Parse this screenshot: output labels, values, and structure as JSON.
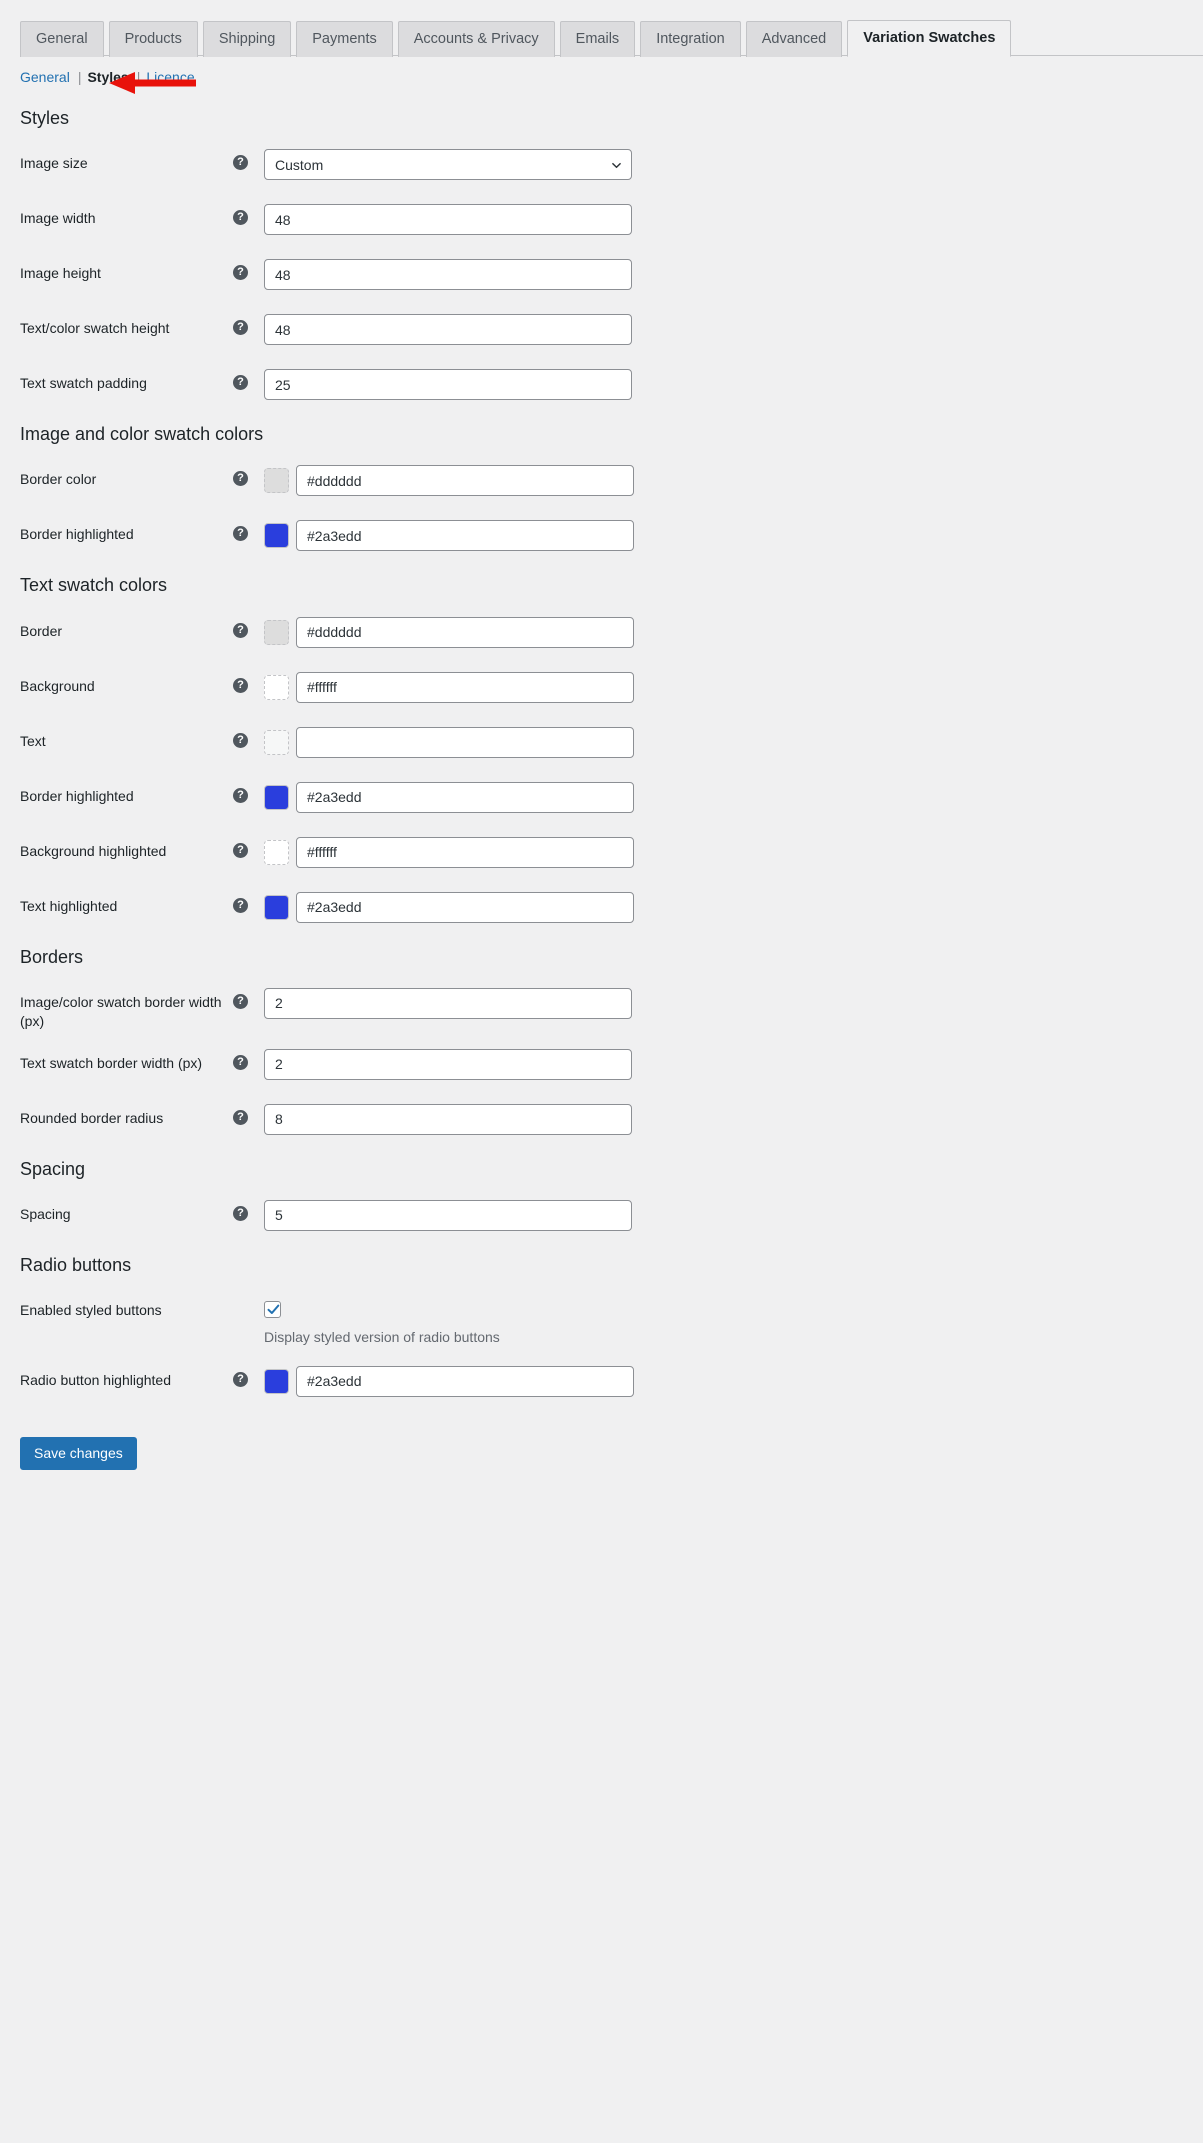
{
  "tabs": [
    {
      "label": "General",
      "active": false
    },
    {
      "label": "Products",
      "active": false
    },
    {
      "label": "Shipping",
      "active": false
    },
    {
      "label": "Payments",
      "active": false
    },
    {
      "label": "Accounts & Privacy",
      "active": false
    },
    {
      "label": "Emails",
      "active": false
    },
    {
      "label": "Integration",
      "active": false
    },
    {
      "label": "Advanced",
      "active": false
    },
    {
      "label": "Variation Swatches",
      "active": true
    }
  ],
  "subnav": {
    "items": [
      {
        "label": "General",
        "current": false
      },
      {
        "label": "Styles",
        "current": true
      },
      {
        "label": "Licence",
        "current": false
      }
    ],
    "separator": "|"
  },
  "annotation": {
    "arrow_color": "#e8120b",
    "points_at": "Licence"
  },
  "help_icon_glyph": "?",
  "sections": [
    {
      "title": "Styles",
      "rows": [
        {
          "label": "Image size",
          "type": "select",
          "value": "Custom",
          "help": true
        },
        {
          "label": "Image width",
          "type": "text",
          "value": "48",
          "help": true
        },
        {
          "label": "Image height",
          "type": "text",
          "value": "48",
          "help": true
        },
        {
          "label": "Text/color swatch height",
          "type": "text",
          "value": "48",
          "help": true
        },
        {
          "label": "Text swatch padding",
          "type": "text",
          "value": "25",
          "help": true
        }
      ]
    },
    {
      "title": "Image and color swatch colors",
      "rows": [
        {
          "label": "Border color",
          "type": "color",
          "value": "#dddddd",
          "swatch": "#dddddd",
          "swatch_style": "dashed",
          "help": true
        },
        {
          "label": "Border highlighted",
          "type": "color",
          "value": "#2a3edd",
          "swatch": "#2a3edd",
          "swatch_style": "solid",
          "help": true
        }
      ]
    },
    {
      "title": "Text swatch colors",
      "rows": [
        {
          "label": "Border",
          "type": "color",
          "value": "#dddddd",
          "swatch": "#dddddd",
          "swatch_style": "dashed",
          "help": true
        },
        {
          "label": "Background",
          "type": "color",
          "value": "#ffffff",
          "swatch": "#ffffff",
          "swatch_style": "dashed",
          "help": true
        },
        {
          "label": "Text",
          "type": "color",
          "value": "",
          "swatch": "#f6f7f7",
          "swatch_style": "dashed",
          "help": true
        },
        {
          "label": "Border highlighted",
          "type": "color",
          "value": "#2a3edd",
          "swatch": "#2a3edd",
          "swatch_style": "solid",
          "help": true
        },
        {
          "label": "Background highlighted",
          "type": "color",
          "value": "#ffffff",
          "swatch": "#ffffff",
          "swatch_style": "dashed",
          "help": true
        },
        {
          "label": "Text highlighted",
          "type": "color",
          "value": "#2a3edd",
          "swatch": "#2a3edd",
          "swatch_style": "solid",
          "help": true
        }
      ]
    },
    {
      "title": "Borders",
      "rows": [
        {
          "label": "Image/color swatch border width (px)",
          "type": "text",
          "value": "2",
          "help": true
        },
        {
          "label": "Text swatch border width (px)",
          "type": "text",
          "value": "2",
          "help": true
        },
        {
          "label": "Rounded border radius",
          "type": "text",
          "value": "8",
          "help": true
        }
      ]
    },
    {
      "title": "Spacing",
      "rows": [
        {
          "label": "Spacing",
          "type": "text",
          "value": "5",
          "help": true
        }
      ]
    },
    {
      "title": "Radio buttons",
      "rows": [
        {
          "label": "Enabled styled buttons",
          "type": "checkbox",
          "checked": true,
          "description": "Display styled version of radio buttons",
          "help": false
        },
        {
          "label": "Radio button highlighted",
          "type": "color",
          "value": "#2a3edd",
          "swatch": "#2a3edd",
          "swatch_style": "solid",
          "help": true
        }
      ]
    }
  ],
  "footer": {
    "save_label": "Save changes",
    "save_color": "#2271b1"
  }
}
